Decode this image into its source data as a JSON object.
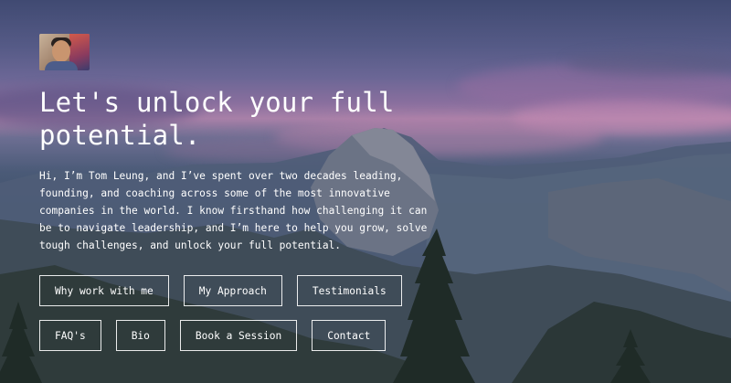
{
  "hero": {
    "title": "Let's unlock your full potential.",
    "intro": "Hi, I’m Tom Leung, and I’ve spent over two decades leading, founding, and coaching across some of the most innovative companies in the world. I know firsthand how challenging it can be to navigate leadership, and I’m here to help you grow, solve tough challenges, and unlock your full potential."
  },
  "nav": {
    "row1": [
      "Why work with me",
      "My Approach",
      "Testimonials"
    ],
    "row2": [
      "FAQ's",
      "Bio",
      "Book a Session",
      "Contact"
    ]
  },
  "colors": {
    "text": "#ffffff",
    "button_border": "#ffffff",
    "sky_top": "#404a72",
    "sunset": "#a880a8",
    "valley": "#1d2922"
  }
}
